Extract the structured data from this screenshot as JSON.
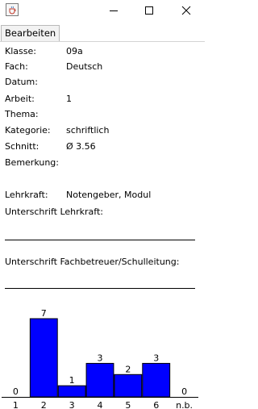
{
  "window": {
    "icon": "java-cup-icon"
  },
  "menu": {
    "items": [
      "Bearbeiten"
    ]
  },
  "details": [
    {
      "label": "Klasse:",
      "value": "09a"
    },
    {
      "label": "Fach:",
      "value": "Deutsch"
    },
    {
      "label": "Datum:",
      "value": ""
    },
    {
      "label": "Arbeit:",
      "value": "1"
    },
    {
      "label": "Thema:",
      "value": ""
    },
    {
      "label": "Kategorie:",
      "value": "schriftlich"
    },
    {
      "label": "Schnitt:",
      "value": "Ø 3.56"
    },
    {
      "label": "Bemerkung:",
      "value": ""
    }
  ],
  "teacher": {
    "label": "Lehrkraft:",
    "value": "Notengeber, Modul",
    "signature_label": "Unterschrift Lehrkraft:",
    "head_signature_label": "Unterschrift Fachbetreuer/Schulleitung:"
  },
  "chart_data": {
    "type": "bar",
    "categories": [
      "1",
      "2",
      "3",
      "4",
      "5",
      "6",
      "n.b."
    ],
    "values": [
      0,
      7,
      1,
      3,
      2,
      3,
      0
    ],
    "ylim": [
      0,
      7
    ],
    "colors": {
      "bar": "#0000ff",
      "border": "#000000"
    },
    "title": "",
    "xlabel": "",
    "ylabel": ""
  }
}
